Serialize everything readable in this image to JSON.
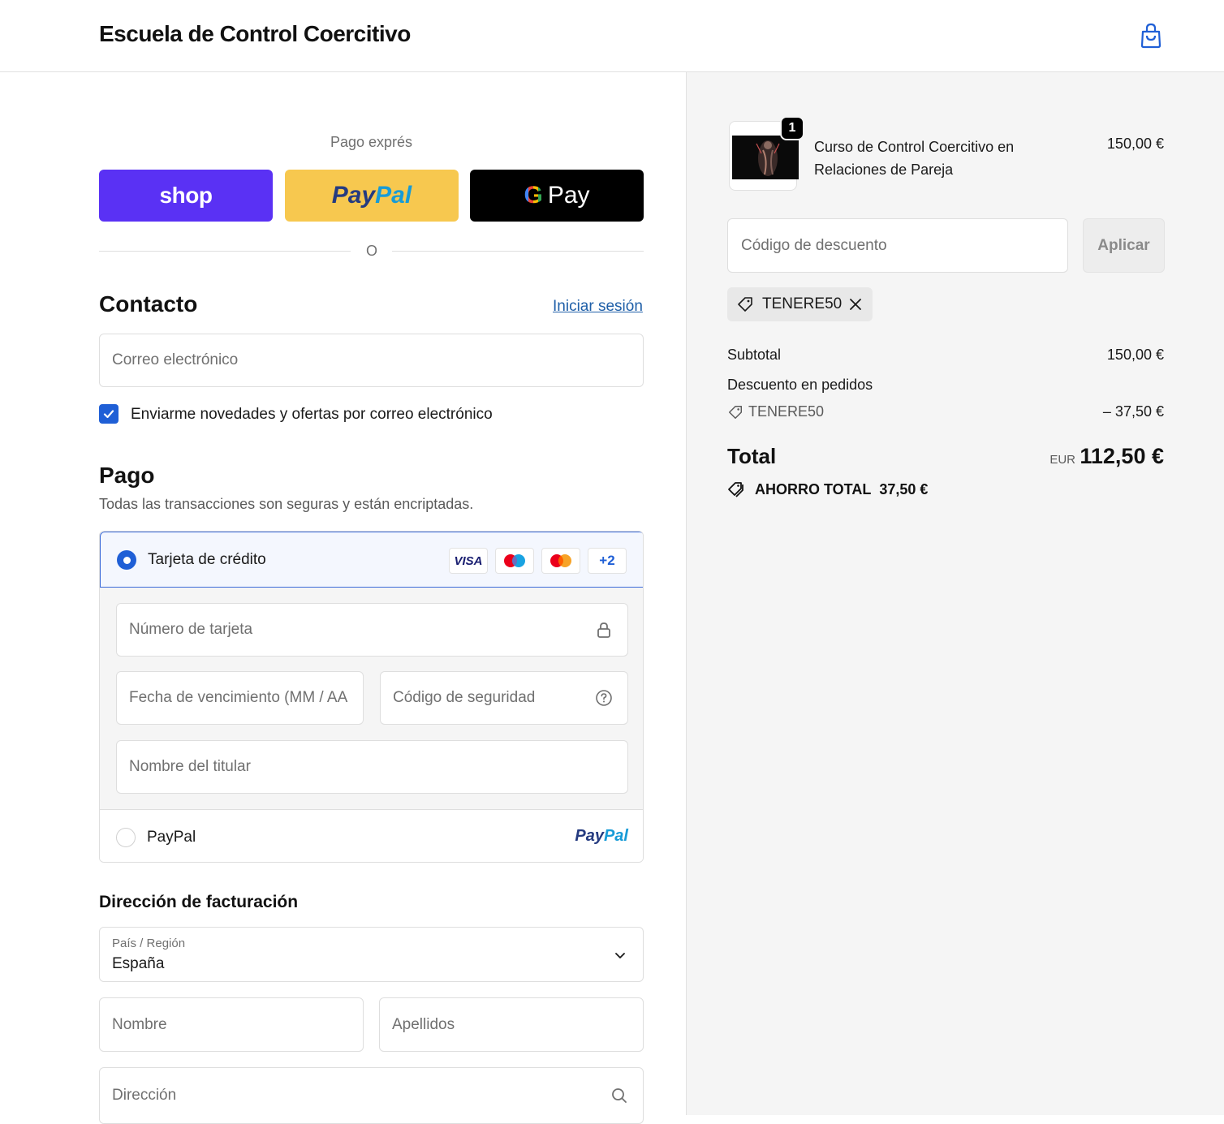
{
  "header": {
    "brand": "Escuela de Control Coercitivo",
    "cart_icon": "shopping-bag-icon"
  },
  "express": {
    "label": "Pago exprés",
    "shop_label": "shop",
    "paypal_part1": "Pay",
    "paypal_part2": "Pal",
    "gpay_g": "G",
    "gpay_label": "Pay",
    "divider_text": "O"
  },
  "contact": {
    "title": "Contacto",
    "login_link": "Iniciar sesión",
    "email_placeholder": "Correo electrónico",
    "newsletter_label": "Enviarme novedades y ofertas por correo electrónico",
    "newsletter_checked": true
  },
  "payment": {
    "title": "Pago",
    "subtitle": "Todas las transacciones son seguras y están encriptadas.",
    "card_option_label": "Tarjeta de crédito",
    "card_badges": [
      "VISA",
      "maestro",
      "mastercard",
      "+2"
    ],
    "card_number_placeholder": "Número de tarjeta",
    "expiry_placeholder": "Fecha de vencimiento (MM / AA",
    "cvc_placeholder": "Código de seguridad",
    "holder_placeholder": "Nombre del titular",
    "paypal_option_label": "PayPal",
    "paypal_logo_part1": "Pay",
    "paypal_logo_part2": "Pal"
  },
  "billing": {
    "title": "Dirección de facturación",
    "country_caption": "País / Región",
    "country_value": "España",
    "first_name_placeholder": "Nombre",
    "last_name_placeholder": "Apellidos",
    "address_placeholder": "Dirección"
  },
  "summary": {
    "quantity": "1",
    "product_name": "Curso de Control Coercitivo en Relaciones de Pareja",
    "product_price": "150,00 €",
    "discount_placeholder": "Código de descuento",
    "apply_label": "Aplicar",
    "applied_code": "TENERE50",
    "subtotal_label": "Subtotal",
    "subtotal_value": "150,00 €",
    "order_discount_label": "Descuento en pedidos",
    "discount_code": "TENERE50",
    "discount_value": "– 37,50 €",
    "total_label": "Total",
    "currency": "EUR",
    "total_value": "112,50 €",
    "savings_label": "AHORRO TOTAL",
    "savings_value": "37,50 €"
  },
  "colors": {
    "accent": "#1f5fd6",
    "shop": "#5a31f4",
    "paypal_yellow": "#f7c84f",
    "gpay": "#000000",
    "summary_bg": "#f5f5f5"
  }
}
